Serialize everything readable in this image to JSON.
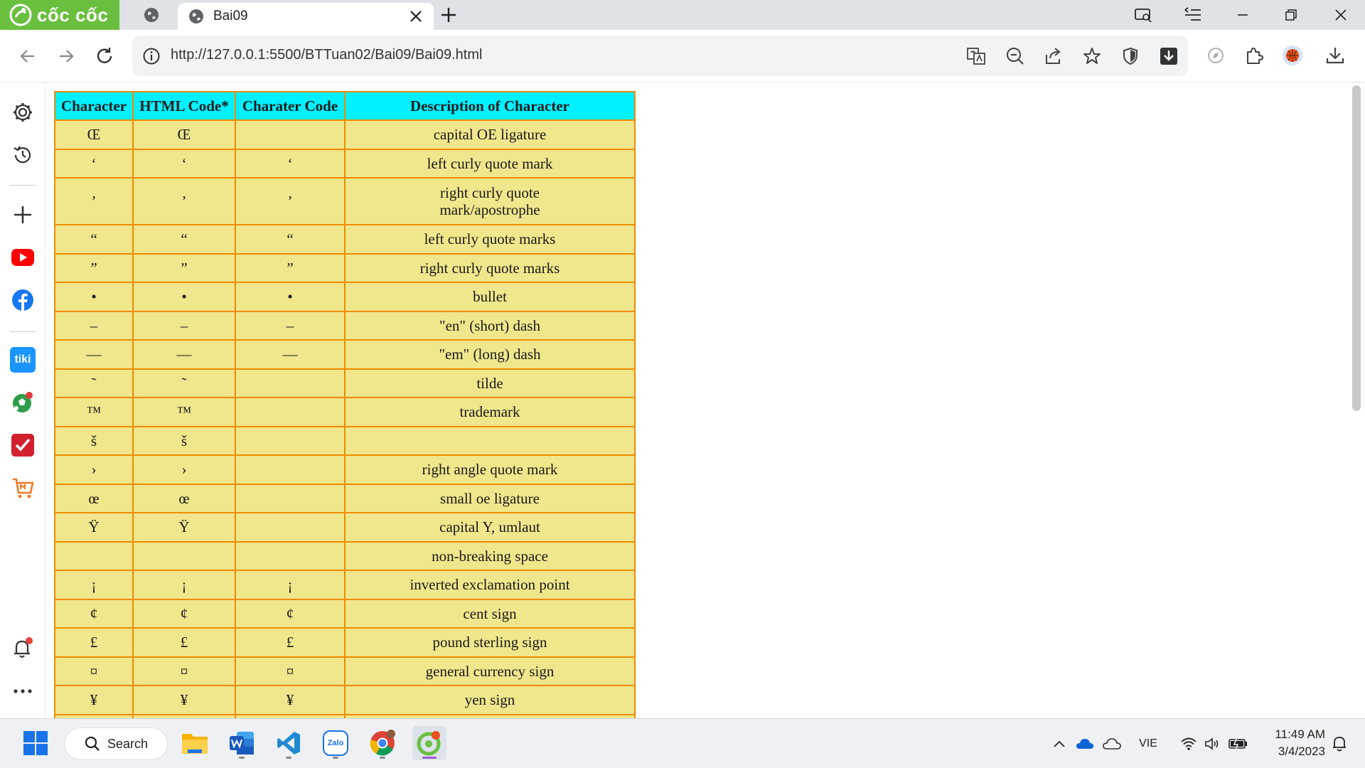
{
  "browser": {
    "brand": "cốc cốc",
    "tab_title": "Bai09",
    "url": "http://127.0.0.1:5500/BTTuan02/Bai09/Bai09.html"
  },
  "table": {
    "headers": [
      "Character",
      "HTML Code*",
      "Charater Code",
      "Description of Character"
    ],
    "rows": [
      [
        "Œ",
        "Œ",
        "",
        "capital OE ligature"
      ],
      [
        "‘",
        "‘",
        "‘",
        "left curly quote mark"
      ],
      [
        "’",
        "’",
        "’",
        "right curly quote mark/apostrophe"
      ],
      [
        "“",
        "“",
        "“",
        "left curly quote marks"
      ],
      [
        "”",
        "”",
        "”",
        "right curly quote marks"
      ],
      [
        "•",
        "•",
        "•",
        "bullet"
      ],
      [
        "–",
        "–",
        "–",
        "\"en\" (short) dash"
      ],
      [
        "—",
        "—",
        "—",
        "\"em\" (long) dash"
      ],
      [
        "˜",
        "˜",
        "",
        "tilde"
      ],
      [
        "™",
        "™",
        "",
        "trademark"
      ],
      [
        "š",
        "š",
        "",
        ""
      ],
      [
        "›",
        "›",
        "",
        "right angle quote mark"
      ],
      [
        "œ",
        "œ",
        "",
        "small oe ligature"
      ],
      [
        "Ÿ",
        "Ÿ",
        "",
        "capital Y, umlaut"
      ],
      [
        "",
        "",
        "",
        "non-breaking space"
      ],
      [
        "¡",
        "¡",
        "¡",
        "inverted exclamation point"
      ],
      [
        "¢",
        "¢",
        "¢",
        "cent sign"
      ],
      [
        "£",
        "£",
        "£",
        "pound sterling sign"
      ],
      [
        "¤",
        "¤",
        "¤",
        "general currency sign"
      ],
      [
        "¥",
        "¥",
        "¥",
        "yen sign"
      ]
    ]
  },
  "taskbar": {
    "search_label": "Search",
    "language": "VIE",
    "time": "11:49 AM",
    "date": "3/4/2023",
    "zalo_label": "Zalo"
  },
  "sidebar": {
    "tiki_label": "tiki"
  },
  "colors": {
    "brand_green": "#6abf3f",
    "table_header": "#00f0ff",
    "table_cell": "#f0e68c",
    "table_border": "#f08c00"
  }
}
